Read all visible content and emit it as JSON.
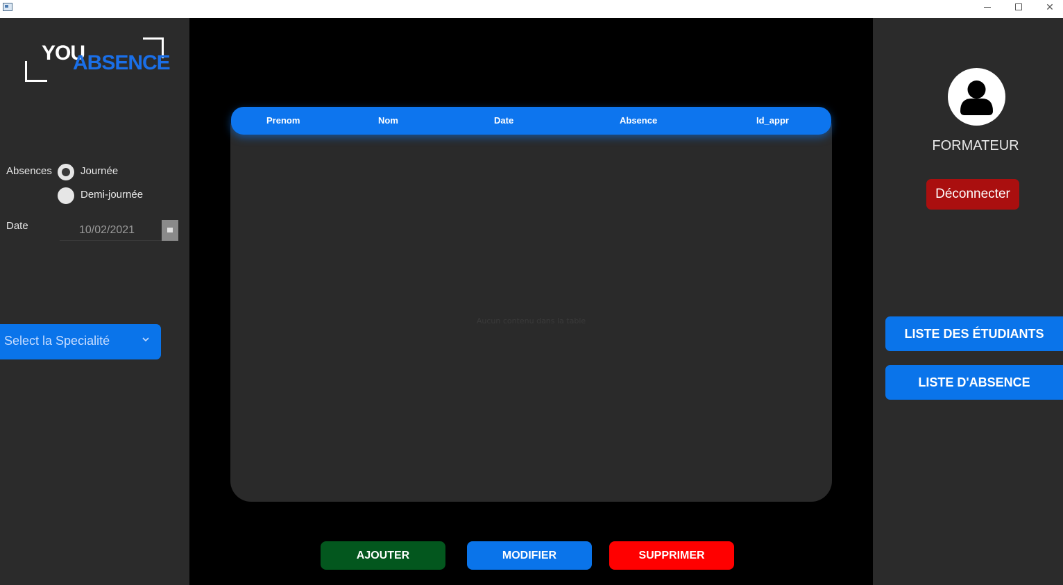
{
  "window": {
    "minimize_glyph": "",
    "maximize_glyph": "",
    "close_glyph": "✕"
  },
  "logo": {
    "part1": "YOU",
    "part2": "ABSENCE"
  },
  "form": {
    "absences_label": "Absences",
    "radio_options": [
      {
        "label": "Journée",
        "checked": true
      },
      {
        "label": "Demi-journée",
        "checked": false
      }
    ],
    "date_label": "Date",
    "date_value": "10/02/2021",
    "speciality_placeholder": "Select la Specialité"
  },
  "table": {
    "columns": [
      "Prenom",
      "Nom",
      "Date",
      "Absence",
      "Id_appr"
    ],
    "empty_text": "Aucun contenu dans la table"
  },
  "actions": {
    "add_label": "AJOUTER",
    "edit_label": "MODIFIER",
    "delete_label": "SUPPRIMER"
  },
  "user": {
    "role": "FORMATEUR",
    "logout_label": "Déconnecter"
  },
  "nav": {
    "students_label": "LISTE DES ÉTUDIANTS",
    "absences_label": "LISTE D'ABSENCE"
  },
  "colors": {
    "accent_blue": "#0a74ea",
    "add_green": "#03571e",
    "delete_red": "#ff0000",
    "logout_red": "#aa0f0f",
    "panel_gray": "#2b2b2b"
  }
}
